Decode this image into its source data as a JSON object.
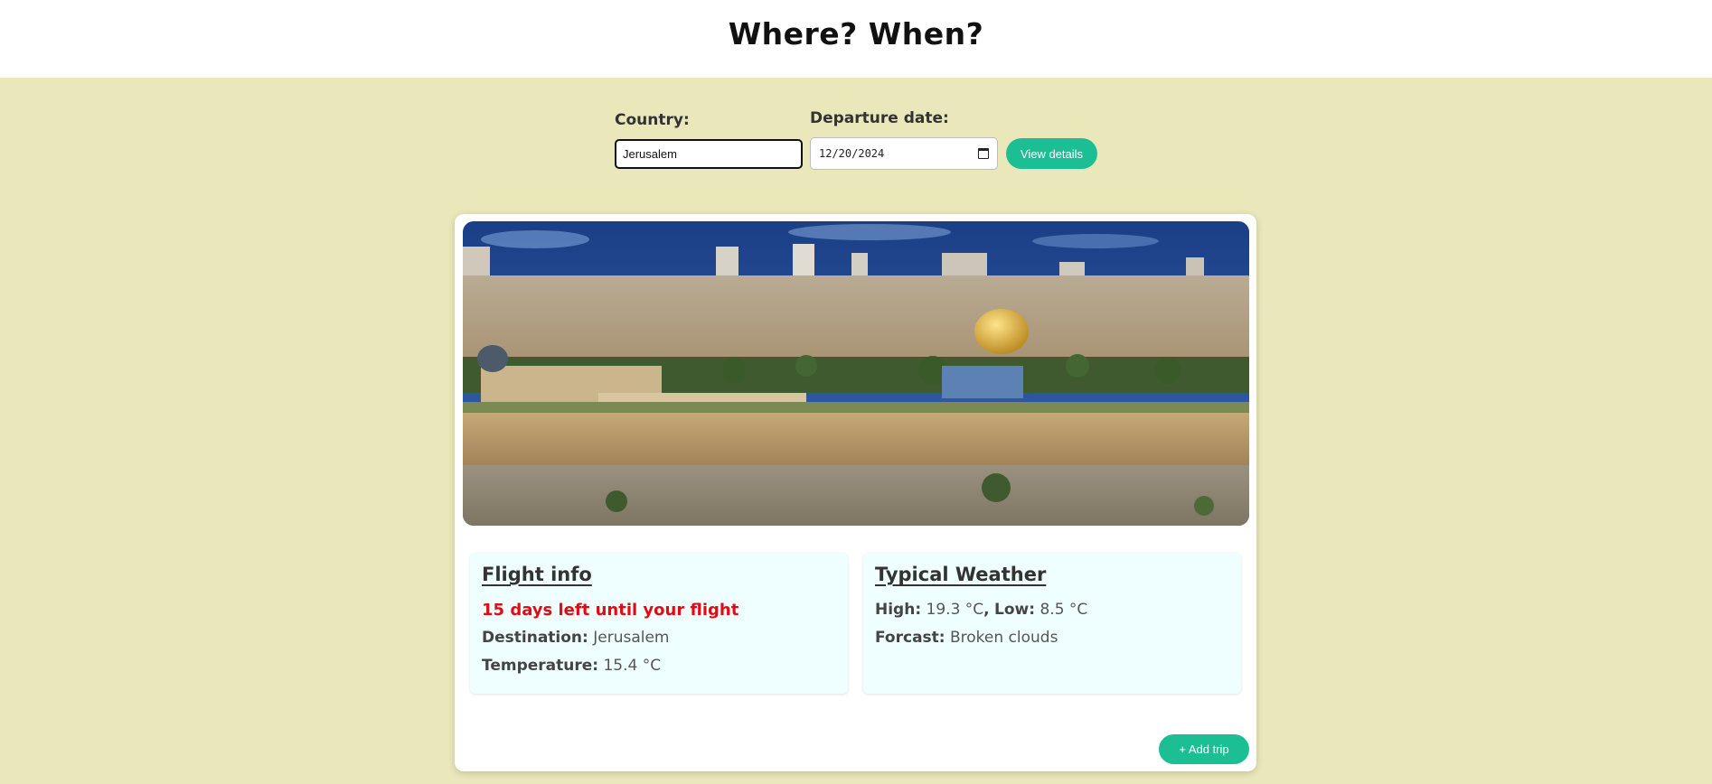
{
  "header": {
    "title": "Where? When?"
  },
  "form": {
    "country_label": "Country:",
    "country_value": "Jerusalem",
    "date_label": "Departure date:",
    "date_value": "12/20/2024",
    "date_icon": "calendar-icon",
    "view_button": "View details"
  },
  "flight_info": {
    "title": "Flight info",
    "countdown": "15 days left until your flight",
    "destination_label": "Destination:",
    "destination_value": "Jerusalem",
    "temperature_label": "Temperature:",
    "temperature_value": "15.4 °C"
  },
  "weather": {
    "title": "Typical Weather",
    "high_label": "High:",
    "high_value": "19.3 °C",
    "separator": ",",
    "low_label": "Low:",
    "low_value": "8.5 °C",
    "forecast_label": "Forcast:",
    "forecast_value": "Broken clouds"
  },
  "add_trip_button": "+ Add trip",
  "colors": {
    "background": "#eae8ba",
    "accent": "#1bbf93",
    "countdown": "#e30b13",
    "info_box": "#efffff"
  }
}
